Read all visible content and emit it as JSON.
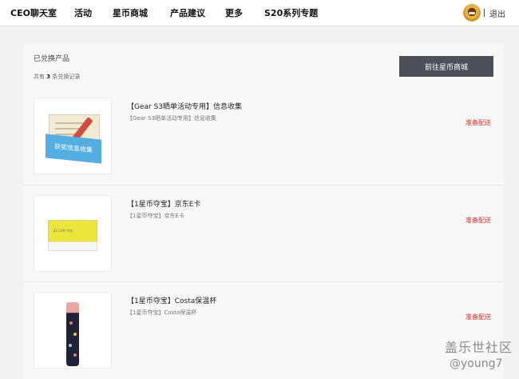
{
  "nav": {
    "items": [
      "CEO聊天室",
      "活动",
      "星币商城",
      "产品建议",
      "更多",
      "S20系列专题"
    ],
    "divider": "|",
    "logout": "退出"
  },
  "panel": {
    "title": "已兑换产品",
    "count_prefix": "共有",
    "count": "3",
    "count_suffix": "条兑换记录",
    "mall_button": "前往星币商城"
  },
  "items": [
    {
      "title": "【Gear S3晒单活动专用】信息收集",
      "subtitle": "【Gear S3晒单活动专用】信息收集",
      "status": "准备配送",
      "thumb_text": "获奖信息收集"
    },
    {
      "title": "【1星币夺宝】京东E卡",
      "subtitle": "【1星币夺宝】京东E卡",
      "status": "准备配送",
      "thumb_text": "JD.COM 京东"
    },
    {
      "title": "【1星币夺宝】Costa保温杯",
      "subtitle": "【1星币夺宝】Costa保温杯",
      "status": "准备配送"
    }
  ],
  "watermark": {
    "title": "盖乐世社区",
    "handle": "@young7"
  },
  "colors": {
    "status": "#c8352b",
    "button": "#4d5059"
  }
}
